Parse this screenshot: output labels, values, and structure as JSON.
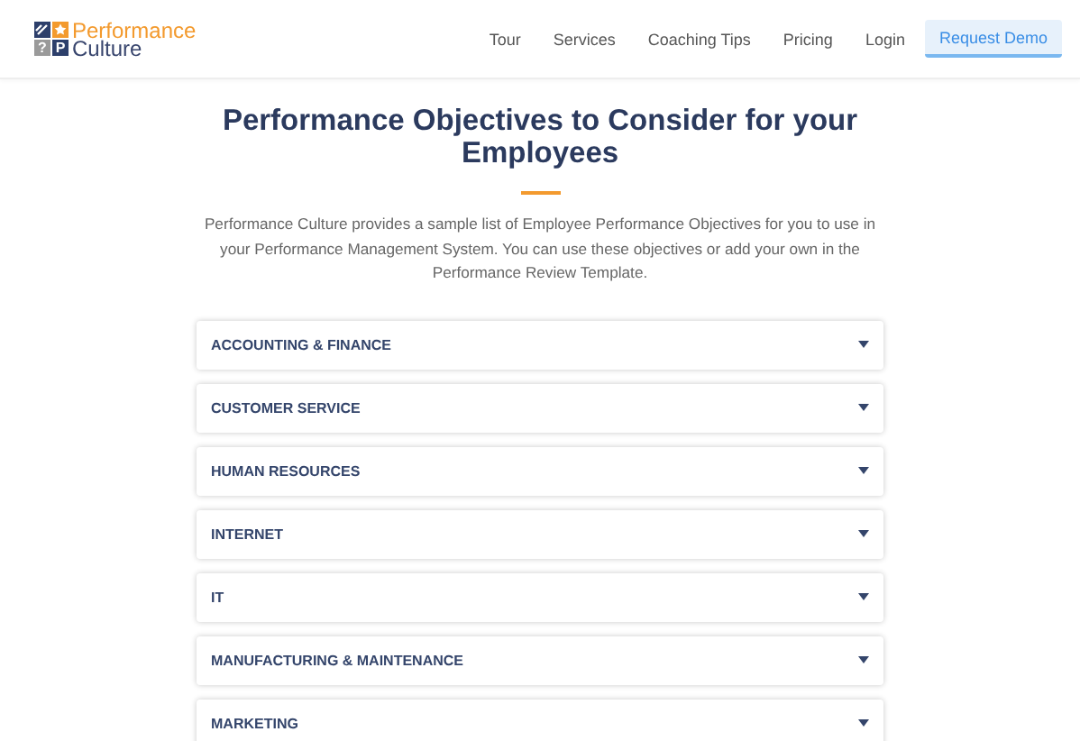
{
  "header": {
    "logo": {
      "tiles": [
        {
          "kind": "slash"
        },
        {
          "kind": "star"
        },
        {
          "kind": "glyph",
          "glyph": "?"
        },
        {
          "kind": "glyph",
          "glyph": "P"
        }
      ],
      "line_1": "Performance",
      "line_2": "Culture"
    },
    "nav": [
      {
        "label": "Tour"
      },
      {
        "label": "Services"
      },
      {
        "label": "Coaching Tips"
      },
      {
        "label": "Pricing"
      },
      {
        "label": "Login"
      }
    ],
    "cta": "Request Demo"
  },
  "title": "Performance Objectives to Consider for your Employees",
  "intro": "Performance Culture provides a sample list of Employee Performance Objectives for you to use in your Performance Management System. You can use these objectives or add your own in the Performance Review Template.",
  "categories": [
    {
      "label": "ACCOUNTING & FINANCE",
      "expanded": false
    },
    {
      "label": "CUSTOMER SERVICE",
      "expanded": false
    },
    {
      "label": "HUMAN RESOURCES",
      "expanded": false
    },
    {
      "label": "INTERNET",
      "expanded": false
    },
    {
      "label": "IT",
      "expanded": false
    },
    {
      "label": "MANUFACTURING & MAINTENANCE",
      "expanded": false
    },
    {
      "label": "MARKETING",
      "expanded": false
    }
  ]
}
